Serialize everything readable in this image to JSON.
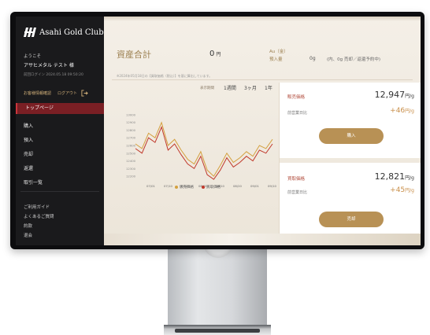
{
  "sidebar": {
    "brand": "Asahi Gold Club",
    "welcome": "ようこそ",
    "username": "アサヒメタル テスト 様",
    "last_login": "前回ログイン 2024.05.18 09:50:20",
    "info_link": "お客様情報確認",
    "logout": "ログアウト",
    "items": [
      {
        "label": "トップページ",
        "active": true
      },
      {
        "label": "購入"
      },
      {
        "label": "預入"
      },
      {
        "label": "売却"
      },
      {
        "label": "返還"
      },
      {
        "label": "取引一覧"
      }
    ],
    "sub_items": [
      {
        "label": "ご利用ガイド"
      },
      {
        "label": "よくあるご質問"
      },
      {
        "label": "約款"
      },
      {
        "label": "退会"
      }
    ]
  },
  "summary": {
    "title": "資産合計",
    "value": "0",
    "unit": "円",
    "metal_label": "Au（金）",
    "metal_sub": "預入量",
    "metal_grams": "0g",
    "metal_detail": "(内、0g 売却／返還予約中)",
    "notice": "※2024年05月18日の【買取価格（税込）】を基に算出しています。"
  },
  "chart": {
    "period_label": "表示期間",
    "periods": [
      "1週間",
      "3ヶ月",
      "1年"
    ]
  },
  "chart_data": {
    "type": "line",
    "x_ticks": [
      "07/01",
      "07/10",
      "07/20",
      "08/01",
      "08/10",
      "08/20",
      "09/01",
      "09/10"
    ],
    "y_ticks": [
      12200,
      12300,
      12400,
      12500,
      12600,
      12700,
      12800,
      12900,
      13000
    ],
    "ylim": [
      12150,
      13050
    ],
    "series": [
      {
        "name": "販売価格",
        "color": "#d4a03e",
        "values": [
          12620,
          12560,
          12760,
          12700,
          12900,
          12600,
          12680,
          12540,
          12420,
          12360,
          12520,
          12280,
          12200,
          12340,
          12500,
          12380,
          12440,
          12520,
          12460,
          12600,
          12560,
          12680
        ]
      },
      {
        "name": "買取価格",
        "color": "#c0392b",
        "values": [
          12560,
          12500,
          12700,
          12640,
          12840,
          12540,
          12620,
          12480,
          12360,
          12300,
          12460,
          12220,
          12160,
          12280,
          12440,
          12320,
          12380,
          12460,
          12400,
          12540,
          12500,
          12620
        ]
      }
    ],
    "grid": false,
    "legend": "bottom"
  },
  "buy_panel": {
    "label": "販売価格",
    "price": "12,947",
    "unit": "円/g",
    "sub": "前営業日比",
    "diff": "+46",
    "diff_unit": "円/g",
    "button": "購入"
  },
  "sell_panel": {
    "label": "買取価格",
    "price": "12,821",
    "unit": "円/g",
    "sub": "前営業日比",
    "diff": "+45",
    "diff_unit": "円/g",
    "button": "売却"
  },
  "colors": {
    "sidebar_bg": "#1a1a1c",
    "active_nav": "#7a1f24",
    "gold_button": "#b89155",
    "accent_gold": "#9b7f4e"
  }
}
